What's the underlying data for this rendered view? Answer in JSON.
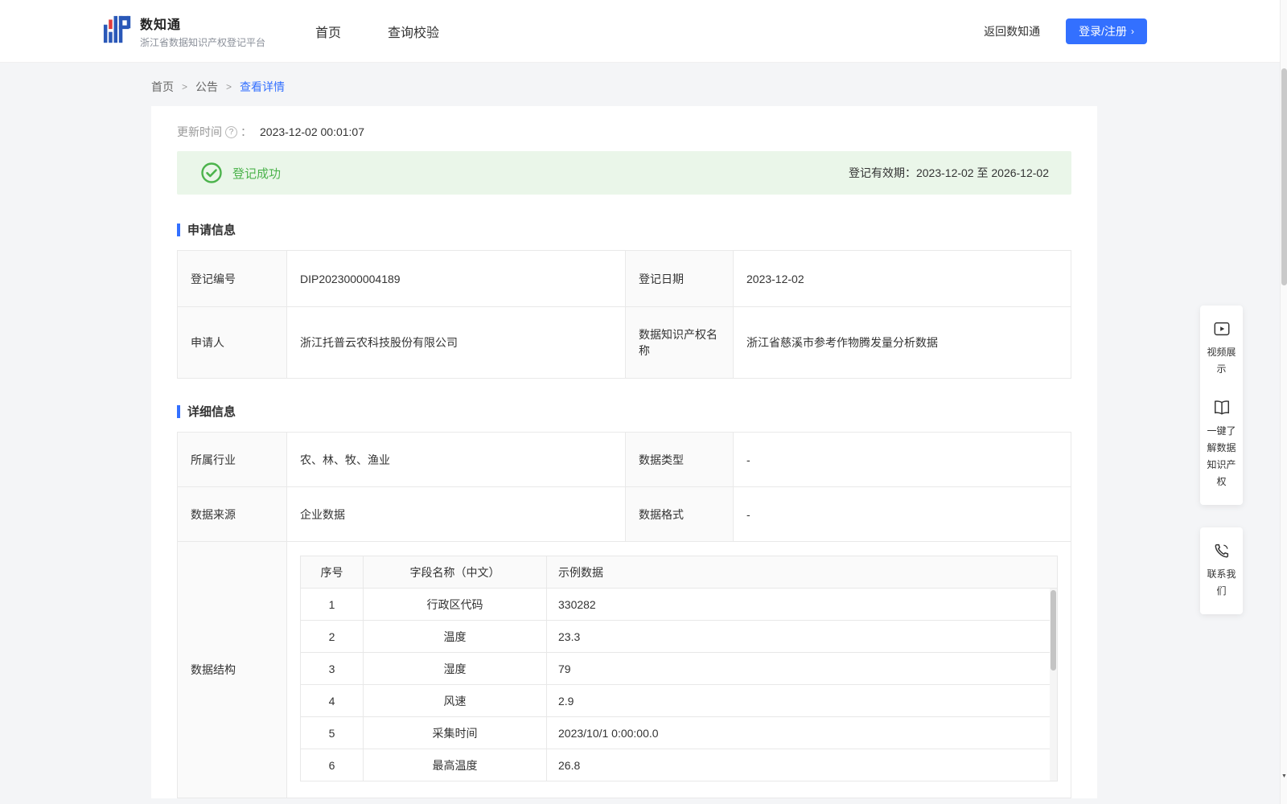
{
  "colors": {
    "accent": "#3370ff",
    "success": "#4cb34c",
    "success_bg": "#eaf6e9"
  },
  "header": {
    "logo_title": "数知通",
    "logo_subtitle": "浙江省数据知识产权登记平台",
    "nav": {
      "home": "首页",
      "verify": "查询校验"
    },
    "back_link": "返回数知通",
    "login_button": "登录/注册",
    "login_chevron": "›"
  },
  "breadcrumb": {
    "separator": ">",
    "items": {
      "home": "首页",
      "notice": "公告",
      "detail": "查看详情"
    }
  },
  "detail": {
    "update_label": "更新时间",
    "help_glyph": "?",
    "update_colon": "：",
    "update_time": "2023-12-02 00:01:07",
    "banner": {
      "status": "登记成功",
      "validity": "登记有效期：2023-12-02 至 2026-12-02"
    },
    "apply_section": "申请信息",
    "apply": {
      "reg_no_label": "登记编号",
      "reg_no": "DIP2023000004189",
      "reg_date_label": "登记日期",
      "reg_date": "2023-12-02",
      "applicant_label": "申请人",
      "applicant": "浙江托普云农科技股份有限公司",
      "dip_name_label": "数据知识产权名\n称",
      "dip_name": "浙江省慈溪市参考作物腾发量分析数据"
    },
    "detail_section": "详细信息",
    "fields": {
      "industry_label": "所属行业",
      "industry": "农、林、牧、渔业",
      "data_type_label": "数据类型",
      "data_type": "-",
      "source_label": "数据来源",
      "source": "企业数据",
      "format_label": "数据格式",
      "format": "-",
      "structure_label": "数据结构"
    },
    "structure_table": {
      "headers": [
        "序号",
        "字段名称（中文）",
        "示例数据"
      ],
      "rows": [
        [
          "1",
          "行政区代码",
          "330282"
        ],
        [
          "2",
          "温度",
          "23.3"
        ],
        [
          "3",
          "湿度",
          "79"
        ],
        [
          "4",
          "风速",
          "2.9"
        ],
        [
          "5",
          "采集时间",
          "2023/10/1 0:00:00.0"
        ],
        [
          "6",
          "最高温度",
          "26.8"
        ]
      ]
    }
  },
  "floating": {
    "video": "视频展示",
    "learn": "一键了解数据知识产权",
    "contact": "联系我们"
  },
  "scrollbar": {
    "down_glyph": "▼"
  }
}
